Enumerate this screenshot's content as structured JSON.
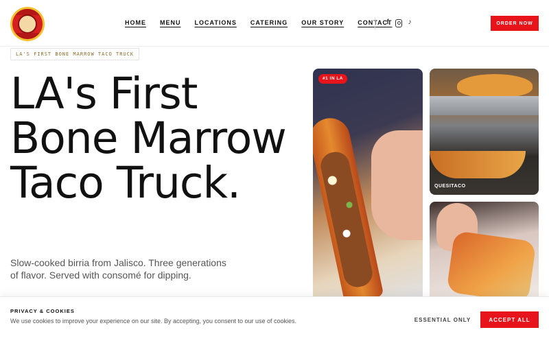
{
  "header": {
    "logo_icon": "taco-truck-logo-icon",
    "nav": [
      {
        "label": "HOME"
      },
      {
        "label": "MENU"
      },
      {
        "label": "LOCATIONS"
      },
      {
        "label": "CATERING"
      },
      {
        "label": "OUR STORY"
      },
      {
        "label": "CONTACT"
      }
    ],
    "social": [
      "facebook-icon",
      "instagram-icon",
      "tiktok-icon"
    ],
    "order_label": "ORDER NOW"
  },
  "hero": {
    "tag": "LA'S FIRST BONE MARROW TACO TRUCK",
    "headline": "LA's First Bone Marrow Taco Truck.",
    "subtitle": "Slow-cooked birria from Jalisco. Three generations of flavor. Served with consomé for dipping."
  },
  "photos": {
    "main_badge": "#1 IN LA",
    "top_label": "QUESITACO"
  },
  "cookie": {
    "title": "PRIVACY & COOKIES",
    "text": "We use cookies to improve your experience on our site. By accepting, you consent to our use of cookies.",
    "essential_label": "ESSENTIAL ONLY",
    "accept_label": "ACCEPT ALL"
  },
  "colors": {
    "accent": "#e8141b",
    "tag_text": "#8a6a2a"
  }
}
